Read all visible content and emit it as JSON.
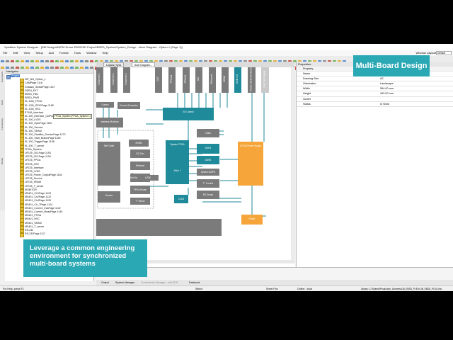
{
  "window": {
    "title": "Xpedition System Designer - [DM Design\\ADPM Drone EBSD\\SD Project\\EBSD_System\\System_Design - block Diagram - Option 1 (Page 1)]"
  },
  "menu": [
    "File",
    "Edit",
    "View",
    "Setup",
    "Add",
    "Format",
    "Tools",
    "Window",
    "Help"
  ],
  "window_layouts": {
    "label": "Window Layouts:",
    "value": "Default"
  },
  "zoom": {
    "value": "1.000000"
  },
  "navigator": {
    "title": "Navigator",
    "items": [
      {
        "label": "Project",
        "root": true,
        "selected": true
      },
      {
        "label": "ISP_NN_Option_1"
      },
      {
        "label": "CAMPage 1116"
      },
      {
        "label": "Chassis_SwitchPage 1157"
      },
      {
        "label": "DDR4_EXT"
      },
      {
        "label": "EBSD_FAN"
      },
      {
        "label": "EBSD_PWR"
      },
      {
        "label": "EL.1GB_FPGA"
      },
      {
        "label": "EL.1GB_GPIOPage 1165"
      },
      {
        "label": "EL.1GB_HSC"
      },
      {
        "label": "E7106_Interface"
      },
      {
        "label": "EL.100_Interface_CtrlPage 1167"
      },
      {
        "label": "EL.100_LVDS"
      },
      {
        "label": "EL.100_OptoPage 1190"
      },
      {
        "label": "EL.100_Service"
      },
      {
        "label": "EL.100_SRAM"
      },
      {
        "label": "EL.100_StartBut_ServicePage 1170"
      },
      {
        "label": "EL.100_Start_ButtonPage 1189"
      },
      {
        "label": "EL.100_TriggerPage 1198"
      },
      {
        "label": "EL.100_T_sense"
      },
      {
        "label": "FPGA_System"
      },
      {
        "label": "LFE25_CK1Page 1193"
      },
      {
        "label": "LFE25_CK1Page 1194"
      },
      {
        "label": "LFE25_FPGA"
      },
      {
        "label": "LFE25_HSC"
      },
      {
        "label": "LFE25_Interface"
      },
      {
        "label": "LFE25_LVDS"
      },
      {
        "label": "LFE25_Power_OutputPage 1164"
      },
      {
        "label": "LFE25_Service"
      },
      {
        "label": "LFE25_SRAM"
      },
      {
        "label": "LFE25_T_sense"
      },
      {
        "label": "MONITOR"
      },
      {
        "label": "MS401_Ch1Page 1123"
      },
      {
        "label": "MS401_Ch2Page 1122"
      },
      {
        "label": "MS401_Ch4Page 1125"
      },
      {
        "label": "MS401_Ch_7Page 1124"
      },
      {
        "label": "MS401_Current_EasPage 1142"
      },
      {
        "label": "MS401_Current_MeasPage 1145"
      },
      {
        "label": "MS401_FPGA"
      },
      {
        "label": "MS401_HSC"
      },
      {
        "label": "MS401_SRAM"
      },
      {
        "label": "MS401_T_sense"
      },
      {
        "label": "RS-232"
      },
      {
        "label": "RS-232Page 1117"
      }
    ],
    "tooltip": "FPGA_System (FPGA_System 1)"
  },
  "side_tabs": [
    "Documents",
    "Parts",
    "Connectivity",
    "Blocks"
  ],
  "doc_tabs": [
    "Logical_Sys1",
    "Arch Diagram..."
  ],
  "diagram": {
    "connectors": [
      "Channel 1",
      "Channel 2",
      "Channel 4",
      "DVI",
      "FPGA1",
      "FPGA2",
      "I2C",
      "Ethernet",
      "HDMI",
      "USB 3.0",
      "Power and Fan Board",
      "Internal Supply"
    ],
    "blocks": {
      "io_control": "I/O Control",
      "control": "Control",
      "current_generator": "Current Generator",
      "interface_monitors": "Interface Monitors",
      "self_calib": "Self Calibr",
      "sram": "SRAM",
      "i2c_dev": "I2C Dev",
      "ethernet": "Ethernet",
      "hot_swap": "Hot Swap Controller",
      "fpga_power": "FPGA Power",
      "t_sense": "T° Sense",
      "service": "Service",
      "lvds_left": "LVDS",
      "system_fpga": "System FPGA",
      "xilinx_7": "Xilinx 7",
      "lvds_bottom": "LVDS",
      "gbits": "Gbits",
      "ddr4_a": "DDR4",
      "ddr4_b": "DDR4",
      "system_smps": "System SMPS",
      "t_sense_right": "T° Control",
      "rs_sense": "RS Sense",
      "power_supply": "LFE25 Power Supply",
      "power_small": "Power"
    }
  },
  "properties": {
    "title": "Properties",
    "rows": [
      {
        "k": "Property",
        "v": "Value",
        "hdr": true
      },
      {
        "k": "Name",
        "v": ""
      },
      {
        "k": "Drawing Size",
        "v": "A2"
      },
      {
        "k": "Orientation",
        "v": "Landscape"
      },
      {
        "k": "Width",
        "v": "594.00 mm"
      },
      {
        "k": "Height",
        "v": "420.00 mm"
      },
      {
        "k": "Owner",
        "v": ""
      },
      {
        "k": "Status",
        "v": "In Work"
      }
    ]
  },
  "bottom_tabs": [
    "Output",
    "System Manager",
    "Connectivity Manager - edit SDS",
    "Databook"
  ],
  "status_bar": {
    "help": "For Help, press F1",
    "mode": "Select",
    "sheet": "Sheet Pos",
    "online": "Online - local",
    "library": "Library: C:\\Shared\\Production_Libraries\\LIB_EBSD_PLEU\\LIB_EBSD_PLEU.lmc"
  },
  "overlay": {
    "badge": "Multi-Board Design",
    "caption": "Leverage a common engineering environment for synchronized multi-board systems"
  },
  "colors": {
    "accent_teal": "#2aa8b4",
    "block_gray": "#7b7b7b",
    "block_teal": "#1f8a9a",
    "block_orange": "#f5a53a"
  }
}
